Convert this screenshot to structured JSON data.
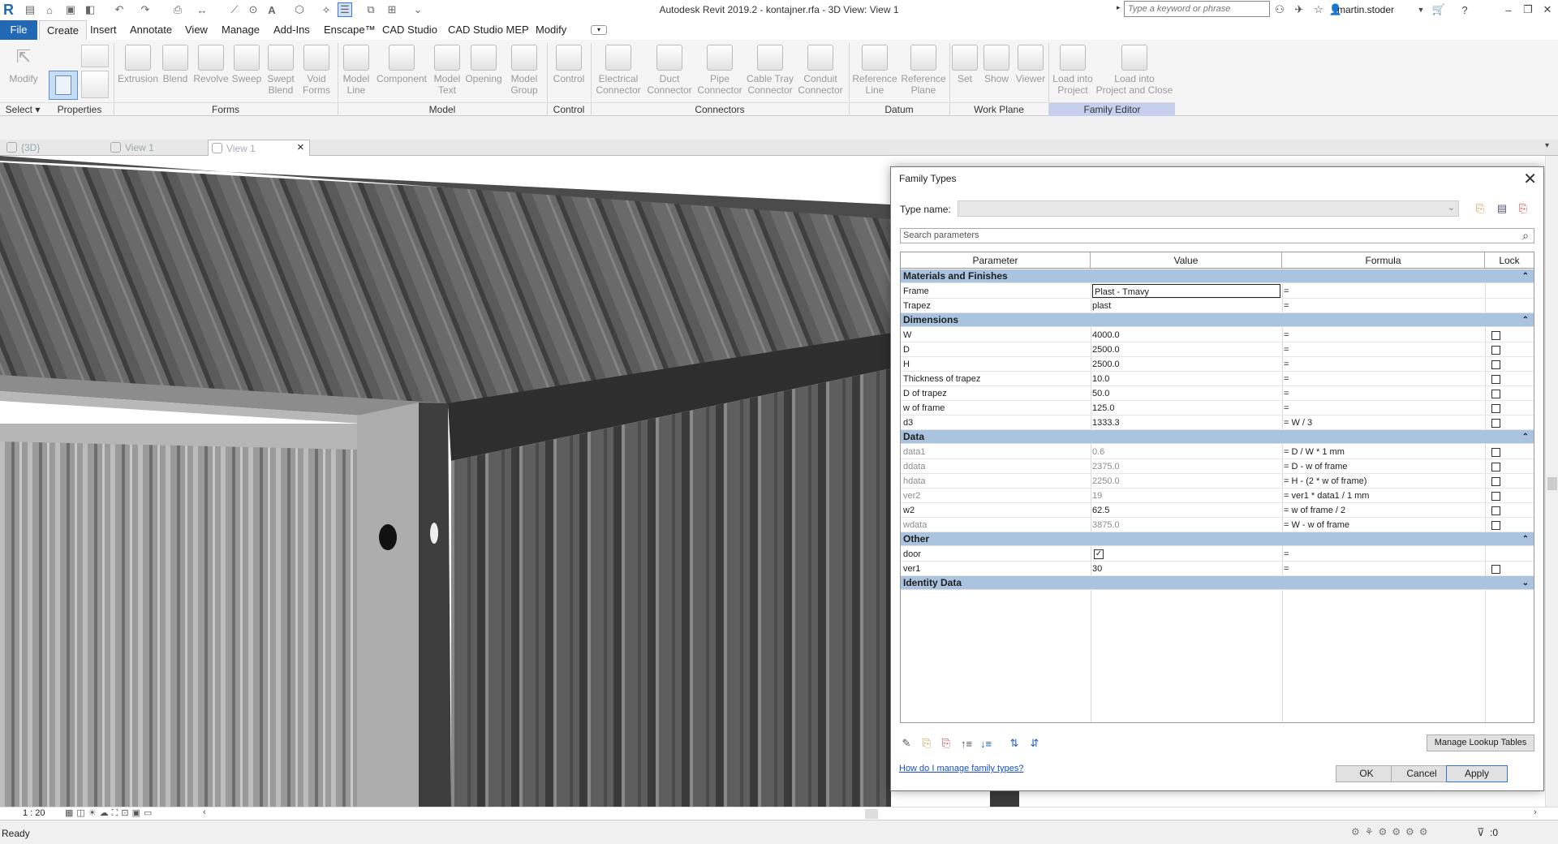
{
  "window": {
    "title": "Autodesk Revit 2019.2 - kontajner.rfa - 3D View: View 1"
  },
  "search": {
    "placeholder": "Type a keyword or phrase"
  },
  "user": {
    "name": "martin.stoder"
  },
  "menu": {
    "tabs": [
      "File",
      "Create",
      "Insert",
      "Annotate",
      "View",
      "Manage",
      "Add-Ins",
      "Enscape™",
      "CAD Studio",
      "CAD Studio MEP",
      "Modify"
    ],
    "active": "Create"
  },
  "ribbon": {
    "select": {
      "modify": "Modify",
      "select_label": "Select"
    },
    "properties_label": "Properties",
    "forms": {
      "label": "Forms",
      "buttons": [
        "Extrusion",
        "Blend",
        "Revolve",
        "Sweep",
        "Swept\nBlend",
        "Void\nForms"
      ]
    },
    "model": {
      "label": "Model",
      "buttons": [
        "Model\nLine",
        "Component",
        "Model\nText",
        "Opening",
        "Model\nGroup"
      ]
    },
    "control": {
      "label": "Control",
      "buttons": [
        "Control"
      ]
    },
    "connectors": {
      "label": "Connectors",
      "buttons": [
        "Electrical\nConnector",
        "Duct\nConnector",
        "Pipe\nConnector",
        "Cable Tray\nConnector",
        "Conduit\nConnector"
      ]
    },
    "datum": {
      "label": "Datum",
      "buttons": [
        "Reference\nLine",
        "Reference\nPlane"
      ]
    },
    "workplane": {
      "label": "Work Plane",
      "buttons": [
        "Set",
        "Show",
        "Viewer"
      ]
    },
    "family_editor": {
      "label": "Family Editor",
      "buttons": [
        "Load into\nProject",
        "Load into\nProject and Close"
      ]
    }
  },
  "view_tabs": [
    {
      "label": "{3D}"
    },
    {
      "label": "View 1"
    },
    {
      "label": "View 1",
      "close": "×"
    }
  ],
  "dialog": {
    "title": "Family Types",
    "close": "✕",
    "type_name_label": "Type name:",
    "search_placeholder": "Search parameters",
    "columns": {
      "parameter": "Parameter",
      "value": "Value",
      "formula": "Formula",
      "lock": "Lock"
    },
    "groups": [
      {
        "name": "Materials and Finishes",
        "toggle": "⌃",
        "rows": [
          {
            "name": "Frame",
            "value": "Plast - Tmavy",
            "formula": "=",
            "lock": null,
            "editing": true
          },
          {
            "name": "Trapez",
            "value": "plast",
            "formula": "=",
            "lock": null
          }
        ]
      },
      {
        "name": "Dimensions",
        "toggle": "⌃",
        "rows": [
          {
            "name": "W",
            "value": "4000.0",
            "formula": "=",
            "lock": false
          },
          {
            "name": "D",
            "value": "2500.0",
            "formula": "=",
            "lock": false
          },
          {
            "name": "H",
            "value": "2500.0",
            "formula": "=",
            "lock": false
          },
          {
            "name": "Thickness of trapez",
            "value": "10.0",
            "formula": "=",
            "lock": false
          },
          {
            "name": "D of trapez",
            "value": "50.0",
            "formula": "=",
            "lock": false
          },
          {
            "name": "w of frame",
            "value": "125.0",
            "formula": "=",
            "lock": false
          },
          {
            "name": "d3",
            "value": "1333.3",
            "formula": "= W / 3",
            "lock": false
          }
        ]
      },
      {
        "name": "Data",
        "toggle": "⌃",
        "rows": [
          {
            "name": "data1",
            "value": "0.6",
            "formula": "= D / W * 1 mm",
            "lock": false,
            "gray": true
          },
          {
            "name": "ddata",
            "value": "2375.0",
            "formula": "= D - w of frame",
            "lock": false,
            "gray": true
          },
          {
            "name": "hdata",
            "value": "2250.0",
            "formula": "= H - (2 * w of frame)",
            "lock": false,
            "gray": true
          },
          {
            "name": "ver2",
            "value": "19",
            "formula": "= ver1 * data1 / 1 mm",
            "lock": false,
            "gray": true
          },
          {
            "name": "w2",
            "value": "62.5",
            "formula": "= w of frame / 2",
            "lock": false
          },
          {
            "name": "wdata",
            "value": "3875.0",
            "formula": "= W - w of frame",
            "lock": false,
            "gray": true
          }
        ]
      },
      {
        "name": "Other",
        "toggle": "⌃",
        "rows": [
          {
            "name": "door",
            "value": "",
            "checkbox": true,
            "formula": "=",
            "lock": null
          },
          {
            "name": "ver1",
            "value": "30",
            "formula": "=",
            "lock": false
          }
        ]
      },
      {
        "name": "Identity Data",
        "toggle": "⌄",
        "rows": []
      }
    ],
    "manage_lookup": "Manage Lookup Tables",
    "help_link": "How do I manage family types?",
    "ok": "OK",
    "cancel": "Cancel",
    "apply": "Apply"
  },
  "view_status": {
    "scale": "1 : 20"
  },
  "status": {
    "text": "Ready",
    "filter_count": ":0"
  }
}
